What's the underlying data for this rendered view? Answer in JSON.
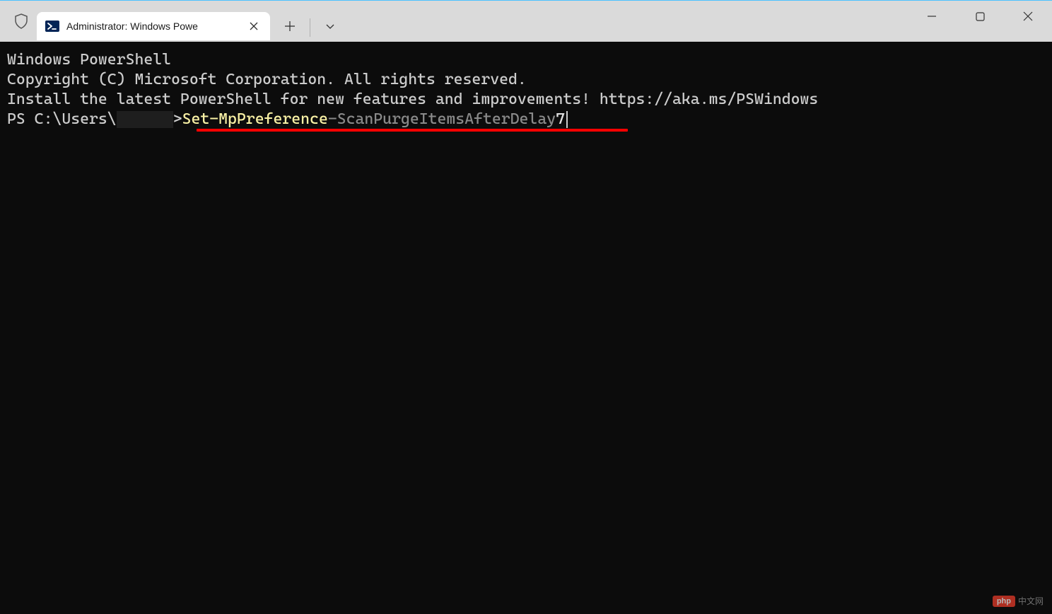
{
  "titlebar": {
    "tab": {
      "title": "Administrator: Windows Powe"
    }
  },
  "terminal": {
    "line1": "Windows PowerShell",
    "line2": "Copyright (C) Microsoft Corporation. All rights reserved.",
    "line3": "",
    "line4": "Install the latest PowerShell for new features and improvements! https://aka.ms/PSWindows",
    "line5": "",
    "prompt_prefix": "PS C:\\Users\\",
    "prompt_suffix": "> ",
    "cmd_name": "Set-MpPreference",
    "cmd_param": " -ScanPurgeItemsAfterDelay ",
    "cmd_value": "7"
  },
  "watermark": {
    "badge": "php",
    "text": "中文网"
  }
}
